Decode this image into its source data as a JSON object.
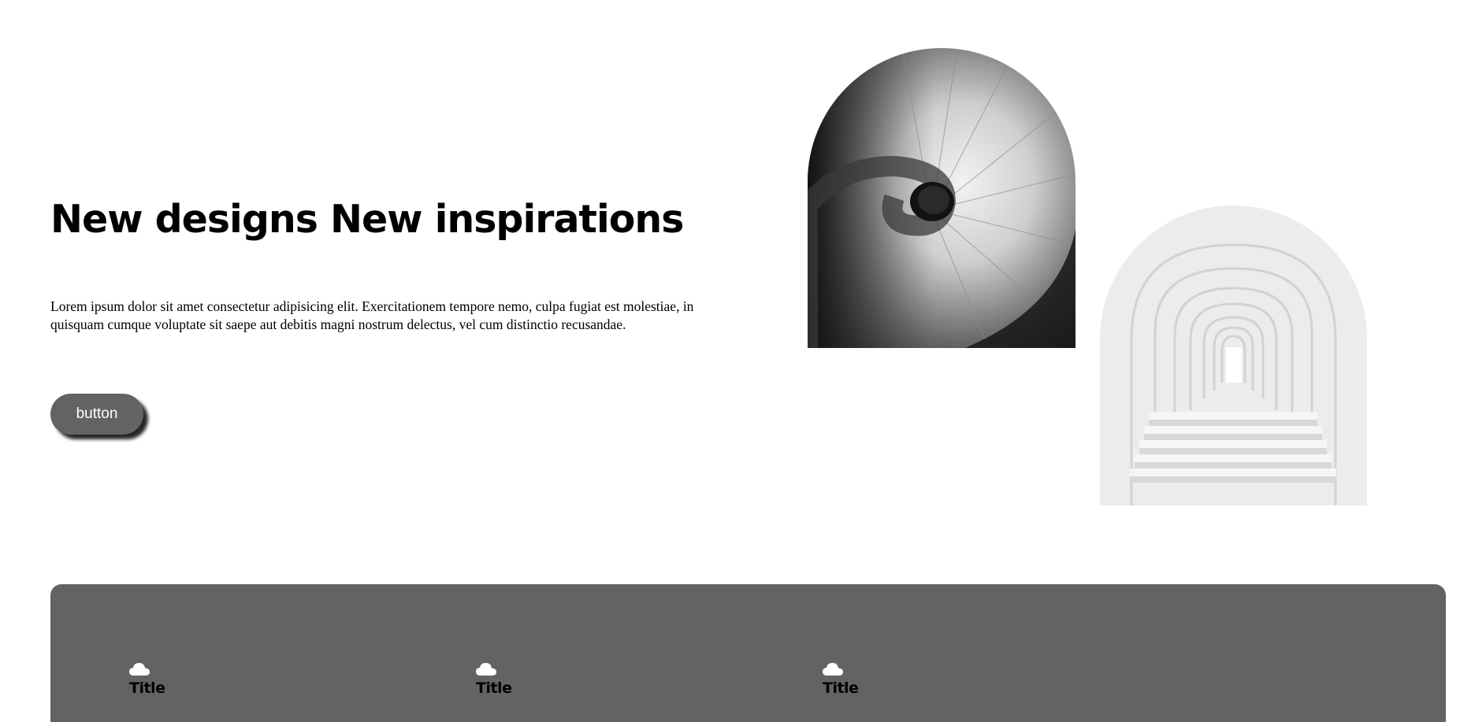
{
  "hero": {
    "title": "New designs New inspirations",
    "text": "Lorem ipsum dolor sit amet consectetur adipisicing elit. Exercitationem tempore nemo, culpa fugiat est molestiae, in quisquam cumque voluptate sit saepe aut debitis magni nostrum delectus, vel cum distinctio recusandae.",
    "button_label": "button"
  },
  "images": [
    {
      "name": "spiral-staircase-image"
    },
    {
      "name": "arched-corridor-image"
    }
  ],
  "features": [
    {
      "icon": "cloud-icon",
      "title": "Title"
    },
    {
      "icon": "cloud-icon",
      "title": "Title"
    },
    {
      "icon": "cloud-icon",
      "title": "Title"
    }
  ],
  "colors": {
    "panel": "#636363",
    "button": "#636363",
    "text": "#000000",
    "icon": "#ffffff"
  }
}
